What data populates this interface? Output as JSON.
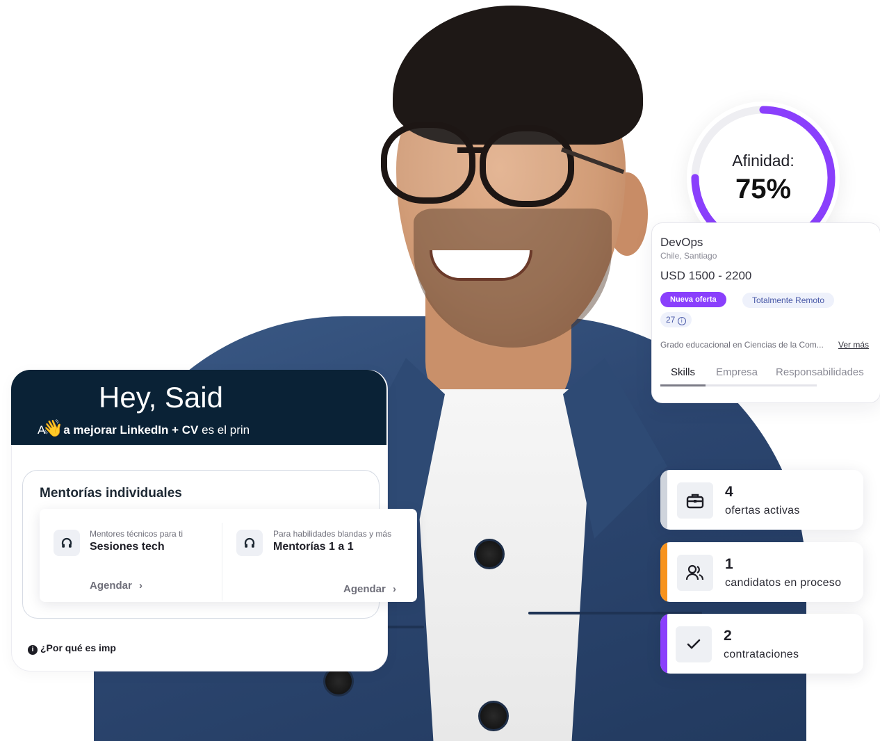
{
  "affinity": {
    "label": "Afinidad:",
    "value_text": "75%",
    "percent": 75,
    "accent": "#8a3ffc"
  },
  "job": {
    "title": "DevOps",
    "location": "Chile, Santiago",
    "salary": "USD 1500 - 2200",
    "badges": {
      "new": "Nueva oferta",
      "remote": "Totalmente Remoto"
    },
    "count": "27",
    "education": "Grado educacional en Ciencias de la Com...",
    "see_more": "Ver más",
    "tabs": [
      "Skills",
      "Empresa",
      "Responsabilidades"
    ],
    "active_tab": "Skills"
  },
  "greeting": {
    "title": "Hey, Said",
    "emoji": "👋",
    "subtitle_bold": "a mejorar LinkedIn + CV",
    "subtitle_prefix": "A",
    "subtitle_rest": "es el prin",
    "header_color": "#0a2236"
  },
  "mentorias": {
    "title": "Mentorías individuales",
    "items": [
      {
        "caption": "Mentores técnicos para ti",
        "title": "Sesiones tech",
        "action": "Agendar",
        "icon": "headphones-icon"
      },
      {
        "caption": "Para habilidades blandas y más",
        "title": "Mentorías 1 a 1",
        "action": "Agendar",
        "icon": "headphones-icon"
      }
    ]
  },
  "footer_hint": {
    "text": "¿Por qué es imp",
    "icon": "info-icon"
  },
  "stats": [
    {
      "number": "4",
      "label": "ofertas activas",
      "icon": "briefcase-icon",
      "accent": "#cfd4dc"
    },
    {
      "number": "1",
      "label": "candidatos en proceso",
      "icon": "users-icon",
      "accent": "#f7931e"
    },
    {
      "number": "2",
      "label": "contrataciones",
      "icon": "check-icon",
      "accent": "#8a3ffc"
    }
  ]
}
